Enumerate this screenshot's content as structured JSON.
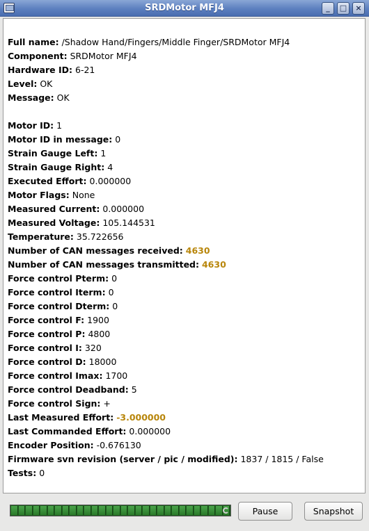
{
  "window": {
    "title": "SRDMotor MFJ4"
  },
  "details": {
    "full_name_label": "Full name:",
    "full_name": "/Shadow Hand/Fingers/Middle Finger/SRDMotor MFJ4",
    "component_label": "Component:",
    "component": "SRDMotor MFJ4",
    "hardware_id_label": "Hardware ID:",
    "hardware_id": "6-21",
    "level_label": "Level:",
    "level": "OK",
    "message_label": "Message:",
    "message": "OK"
  },
  "values": [
    {
      "label": "Motor ID:",
      "value": "1",
      "highlight": false
    },
    {
      "label": "Motor ID in message:",
      "value": "0",
      "highlight": false
    },
    {
      "label": "Strain Gauge Left:",
      "value": "1",
      "highlight": false
    },
    {
      "label": "Strain Gauge Right:",
      "value": "4",
      "highlight": false
    },
    {
      "label": "Executed Effort:",
      "value": "0.000000",
      "highlight": false
    },
    {
      "label": "Motor Flags:",
      "value": " None",
      "highlight": false
    },
    {
      "label": "Measured Current:",
      "value": "0.000000",
      "highlight": false
    },
    {
      "label": "Measured Voltage:",
      "value": "105.144531",
      "highlight": false
    },
    {
      "label": "Temperature:",
      "value": "35.722656",
      "highlight": false
    },
    {
      "label": "Number of CAN messages received:",
      "value": "4630",
      "highlight": true
    },
    {
      "label": "Number of CAN messages transmitted:",
      "value": "4630",
      "highlight": true
    },
    {
      "label": "Force control Pterm:",
      "value": "0",
      "highlight": false
    },
    {
      "label": "Force control Iterm:",
      "value": "0",
      "highlight": false
    },
    {
      "label": "Force control Dterm:",
      "value": "0",
      "highlight": false
    },
    {
      "label": "Force control F:",
      "value": "1900",
      "highlight": false
    },
    {
      "label": "Force control P:",
      "value": "4800",
      "highlight": false
    },
    {
      "label": "Force control I:",
      "value": "320",
      "highlight": false
    },
    {
      "label": "Force control D:",
      "value": "18000",
      "highlight": false
    },
    {
      "label": "Force control Imax:",
      "value": "1700",
      "highlight": false
    },
    {
      "label": "Force control Deadband:",
      "value": "5",
      "highlight": false
    },
    {
      "label": "Force control Sign:",
      "value": "+",
      "highlight": false
    },
    {
      "label": "Last Measured Effort:",
      "value": "-3.000000",
      "highlight": true
    },
    {
      "label": "Last Commanded Effort:",
      "value": "0.000000",
      "highlight": false
    },
    {
      "label": "Encoder Position:",
      "value": "-0.676130",
      "highlight": false
    },
    {
      "label": "Firmware svn revision (server / pic / modified):",
      "value": "1837 / 1815 / False",
      "highlight": false
    },
    {
      "label": "Tests:",
      "value": "0",
      "highlight": false
    }
  ],
  "footer": {
    "progress": 1.0,
    "pause_label": "Pause",
    "snapshot_label": "Snapshot"
  },
  "colors": {
    "highlight": "#b8860b",
    "progress": "#2a7a2a",
    "titlebar": "#5c7fbf"
  },
  "icons": [
    "app-window-icon",
    "minimize-icon",
    "maximize-icon",
    "close-icon",
    "busy-spinner-icon"
  ]
}
